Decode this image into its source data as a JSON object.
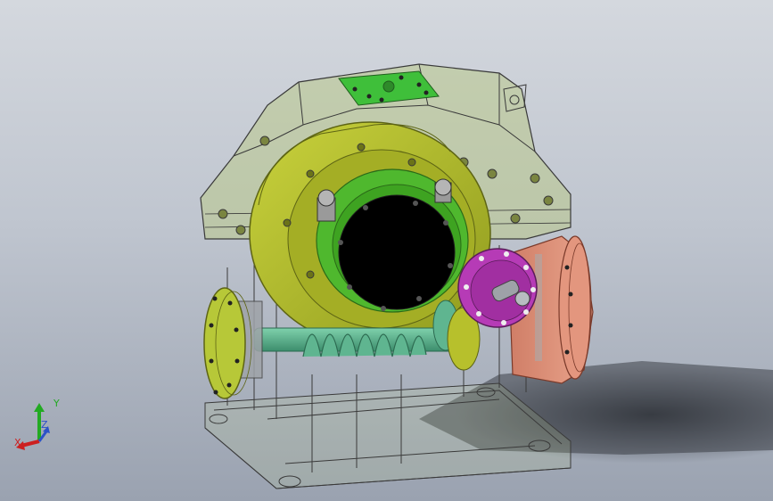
{
  "viewport": {
    "background_top": "#d4d8de",
    "background_bottom": "#9aa2b0"
  },
  "model": {
    "housing_color": "#b9c98a",
    "top_cover_color": "#3fbf3a",
    "worm_wheel_color": "#b7c02c",
    "output_bore_color": "#000000",
    "hub_color": "#4fb82e",
    "worm_shaft_color": "#5fb590",
    "left_end_cap_color": "#b7c838",
    "input_flange_color": "#b63bb6",
    "motor_adapter_color": "#e3967e",
    "outline_color": "#3a3a3a"
  },
  "triad": {
    "x_label": "X",
    "y_label": "Y",
    "z_label": "Z",
    "x_color": "#cc2020",
    "y_color": "#22aa22",
    "z_color": "#2c52c8"
  }
}
